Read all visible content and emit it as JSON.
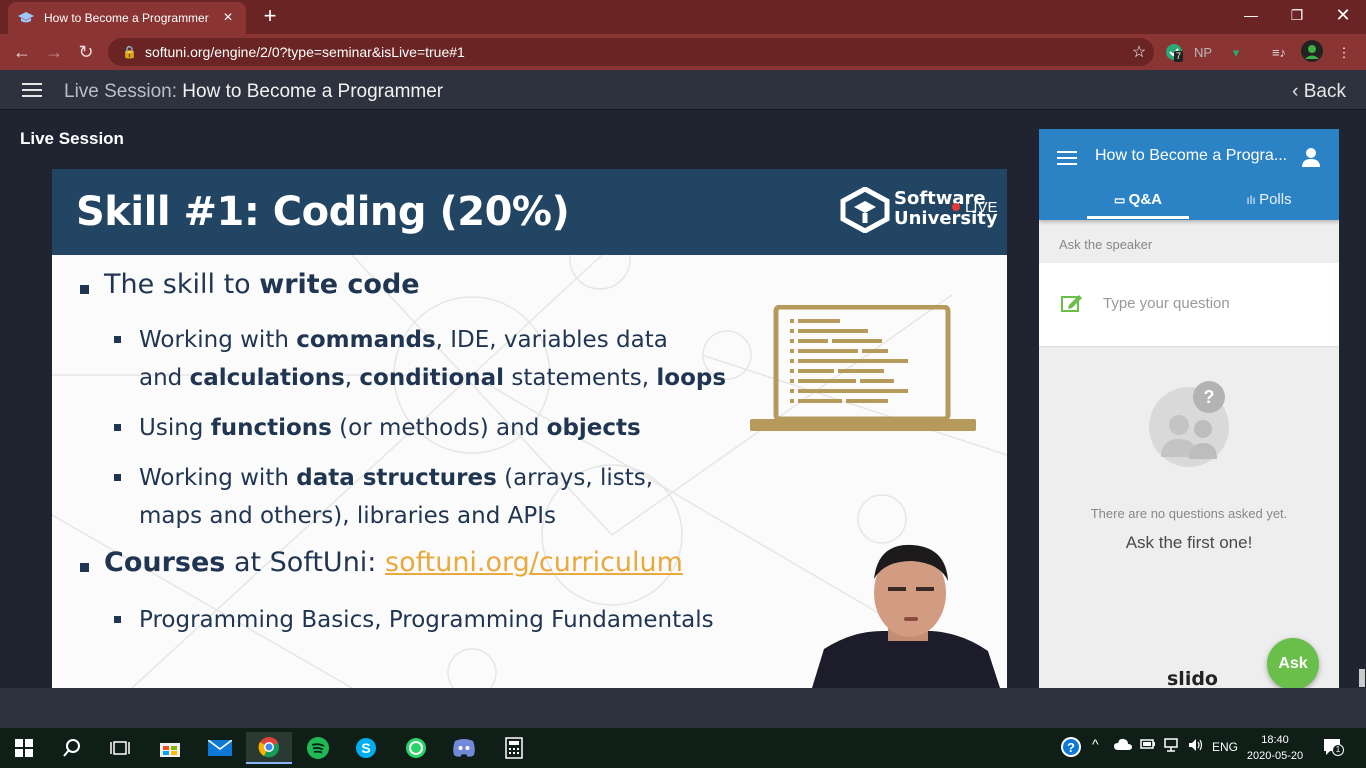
{
  "browser": {
    "tab_title": "How to Become a Programmer",
    "url": "softuni.org/engine/2/0?type=seminar&isLive=true#1",
    "extensions": {
      "badge": "7",
      "np": "NP"
    }
  },
  "app": {
    "header_prefix": "Live Session:",
    "header_title": "How to Become a Programmer",
    "back_label": "Back",
    "section_label": "Live Session"
  },
  "slide": {
    "title": "Skill #1: Coding (20%)",
    "logo_line1": "Software",
    "logo_line2": "University",
    "logo_live": "LIVE",
    "b1_pre": "The skill to ",
    "b1_bold": "write code",
    "s1_a": "Working with ",
    "s1_b": "commands",
    "s1_c": ", IDE, variables data",
    "s1_d": "and ",
    "s1_e": "calculations",
    "s1_f": ", ",
    "s1_g": "conditional",
    "s1_h": " statements, ",
    "s1_i": "loops",
    "s2_a": "Using ",
    "s2_b": "functions",
    "s2_c": " (or methods) and ",
    "s2_d": "objects",
    "s3_a": "Working with ",
    "s3_b": "data structures",
    "s3_c": " (arrays, lists,",
    "s3_d": "maps and others), libraries and APIs",
    "b2_bold": "Courses",
    "b2_mid": " at SoftUni: ",
    "b2_link": "softuni.org/curriculum",
    "s4": "Programming Basics, Programming Fundamentals"
  },
  "slido": {
    "event_title": "How to Become a Progra...",
    "tab_qa": "Q&A",
    "tab_polls": "Polls",
    "ask_speaker": "Ask the speaker",
    "placeholder": "Type your question",
    "no_questions": "There are no questions asked yet.",
    "first_one": "Ask the first one!",
    "ask_button": "Ask",
    "brand": "slido"
  },
  "taskbar": {
    "lang": "ENG",
    "time": "18:40",
    "date": "2020-05-20",
    "notif_count": "1"
  },
  "colors": {
    "browser_frame": "#8a3434",
    "slide_header": "#234564",
    "slido_blue": "#2b83c6",
    "ask_green": "#6abf4b",
    "link_orange": "#e9a93d",
    "laptop_gold": "#b59a5c"
  }
}
